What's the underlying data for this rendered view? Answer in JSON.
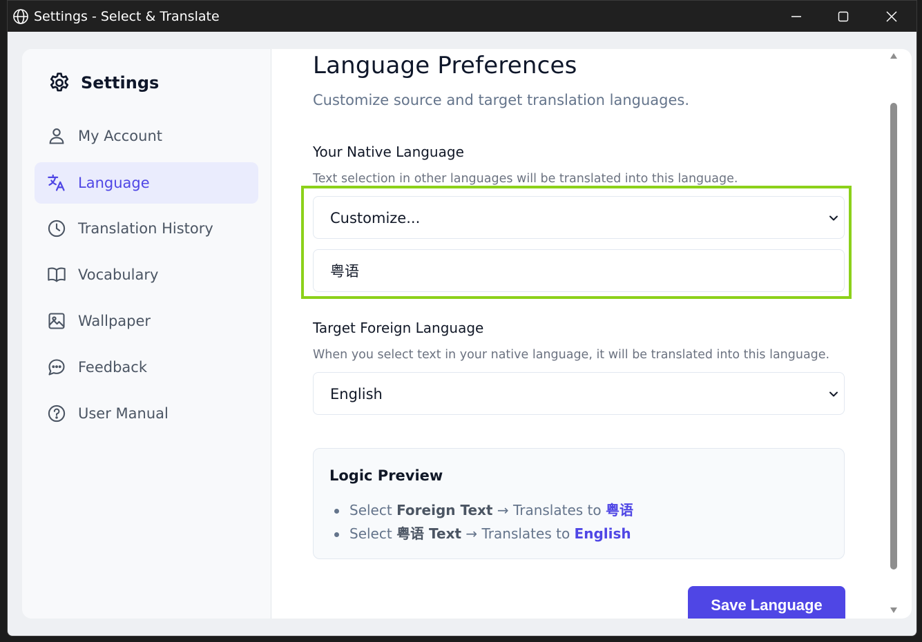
{
  "window": {
    "title": "Settings - Select & Translate",
    "icons": {
      "app": "globe-icon",
      "minimize": "minimize-icon",
      "maximize": "maximize-icon",
      "close": "close-icon"
    }
  },
  "sidebar": {
    "heading": "Settings",
    "heading_icon": "gear-icon",
    "items": [
      {
        "label": "My Account",
        "icon": "user-icon",
        "active": false
      },
      {
        "label": "Language",
        "icon": "translate-icon",
        "active": true
      },
      {
        "label": "Translation History",
        "icon": "clock-icon",
        "active": false
      },
      {
        "label": "Vocabulary",
        "icon": "book-open-icon",
        "active": false
      },
      {
        "label": "Wallpaper",
        "icon": "image-icon",
        "active": false
      },
      {
        "label": "Feedback",
        "icon": "chat-bubble-icon",
        "active": false
      },
      {
        "label": "User Manual",
        "icon": "help-circle-icon",
        "active": false
      }
    ]
  },
  "main": {
    "title": "Language Preferences",
    "subtitle": "Customize source and target translation languages.",
    "native": {
      "title": "Your Native Language",
      "description": "Text selection in other languages will be translated into this language.",
      "select_value": "Customize...",
      "custom_value": "粤语"
    },
    "target": {
      "title": "Target Foreign Language",
      "description": "When you select text in your native language, it will be translated into this language.",
      "select_value": "English"
    },
    "preview": {
      "title": "Logic Preview",
      "line1": {
        "prefix": "Select ",
        "em": "Foreign Text",
        "mid": " → Translates to ",
        "accent": "粤语"
      },
      "line2": {
        "prefix": "Select ",
        "em": "粤语 Text",
        "mid": " → Translates to ",
        "accent": "English"
      }
    },
    "save_label": "Save Language"
  },
  "colors": {
    "accent": "#4f46e5",
    "highlight": "#8cd11a",
    "titlebar": "#202020"
  }
}
